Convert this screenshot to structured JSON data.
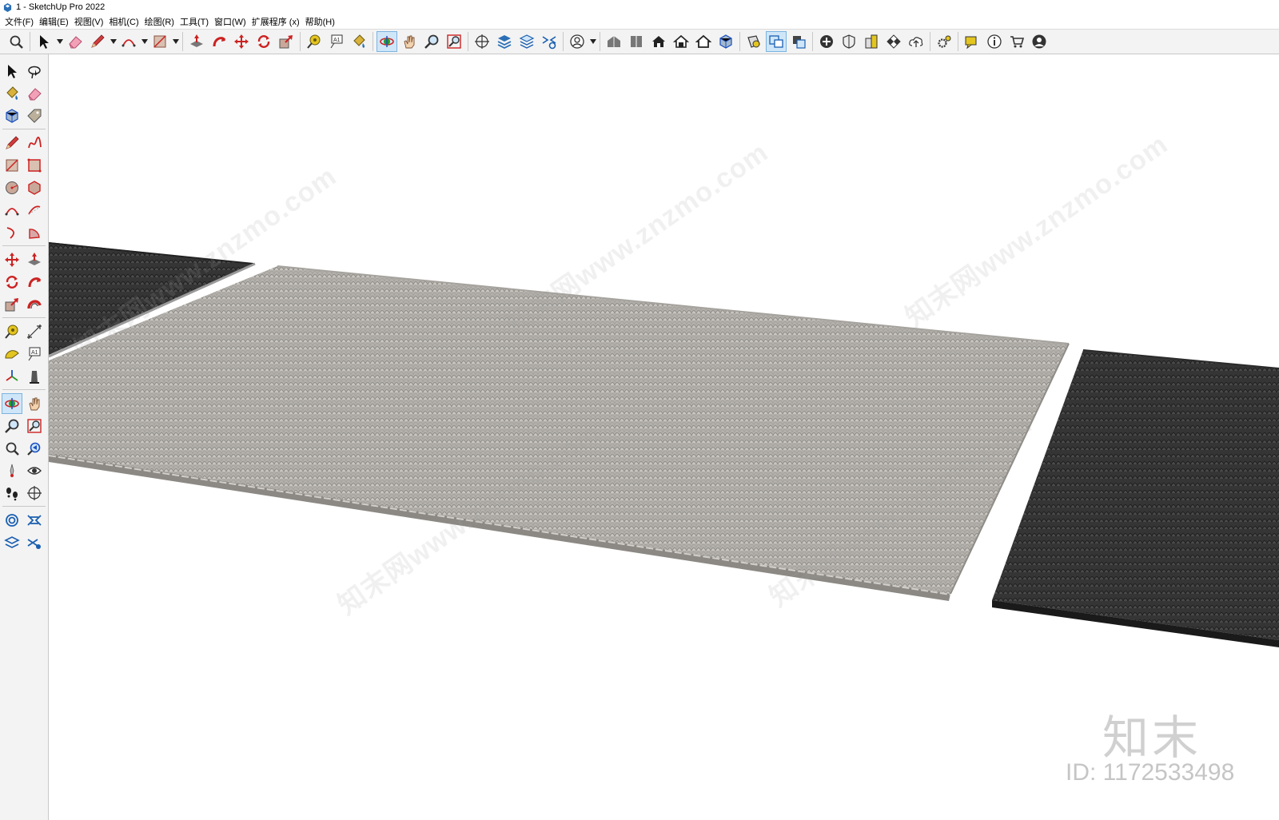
{
  "window": {
    "title": "1 - SketchUp Pro 2022",
    "app_icon": "sketchup-logo-icon"
  },
  "menu": [
    {
      "label": "文件(F)"
    },
    {
      "label": "编辑(E)"
    },
    {
      "label": "视图(V)"
    },
    {
      "label": "相机(C)"
    },
    {
      "label": "绘图(R)"
    },
    {
      "label": "工具(T)"
    },
    {
      "label": "窗口(W)"
    },
    {
      "label": "扩展程序 (x)"
    },
    {
      "label": "帮助(H)"
    }
  ],
  "toolbar": {
    "groups": [
      [
        "zoom-extents-icon"
      ],
      [
        "select-icon",
        "dropdown",
        "eraser-icon",
        "pencil-icon",
        "dropdown",
        "arc-icon",
        "dropdown",
        "rectangle-icon",
        "dropdown"
      ],
      [
        "push-pull-icon",
        "follow-me-icon",
        "move-icon",
        "rotate-icon",
        "scale-icon"
      ],
      [
        "tape-measure-icon",
        "text-icon",
        "paint-bucket-icon"
      ],
      [
        "orbit-icon",
        "pan-icon",
        "zoom-icon",
        "zoom-window-icon"
      ],
      [
        "section-plane-icon",
        "sandbox-icon",
        "layers-icon",
        "scenes-icon"
      ],
      [
        "account-icon",
        "dropdown"
      ],
      [
        "3d-warehouse-icon",
        "extension-warehouse-icon",
        "house-icon",
        "house-open-icon",
        "house-outline-icon",
        "component-icon"
      ],
      [
        "style-icon",
        "outliner-icon",
        "solid-tools-icon"
      ],
      [
        "add-location-icon",
        "shield-icon",
        "building-icon",
        "checker-icon",
        "cloud-upload-icon"
      ],
      [
        "gear-icon"
      ],
      [
        "message-icon",
        "info-icon",
        "cart-icon",
        "user-circle-icon"
      ]
    ],
    "active": [
      "orbit-icon",
      "outliner-icon"
    ]
  },
  "left_toolbar": {
    "rows": [
      [
        "select-icon",
        "lasso-select-icon"
      ],
      [
        "paint-bucket-icon",
        "eraser-icon"
      ],
      [
        "component-icon",
        "tag-icon"
      ],
      [
        "pencil-icon",
        "freehand-icon"
      ],
      [
        "rectangle-icon",
        "rotated-rectangle-icon"
      ],
      [
        "circle-icon",
        "polygon-icon"
      ],
      [
        "arc-icon",
        "two-point-arc-icon"
      ],
      [
        "three-point-arc-icon",
        "pie-icon"
      ],
      [
        "move-icon",
        "push-pull-icon"
      ],
      [
        "rotate-icon",
        "follow-me-icon"
      ],
      [
        "scale-icon",
        "offset-icon"
      ],
      [
        "tape-measure-icon",
        "dimension-icon"
      ],
      [
        "protractor-icon",
        "text-icon"
      ],
      [
        "axes-icon",
        "3d-text-icon"
      ],
      [
        "orbit-icon",
        "pan-icon"
      ],
      [
        "zoom-icon",
        "zoom-window-icon"
      ],
      [
        "zoom-extents-icon",
        "previous-view-icon"
      ],
      [
        "position-camera-icon",
        "look-around-icon"
      ],
      [
        "walk-icon",
        "section-plane-icon"
      ],
      [
        "sandbox-from-contours-icon",
        "sandbox-from-scratch-icon"
      ],
      [
        "smoove-icon",
        "stamp-icon"
      ]
    ],
    "active": [
      "orbit-icon"
    ]
  },
  "scene": {
    "description_colors": {
      "tile_light": "#b9b6b1",
      "tile_light_shadow": "#8a8782",
      "tile_dark": "#3c3c3c",
      "tile_darker": "#222222",
      "ground": "#ffffff"
    },
    "objects": [
      {
        "name": "dark-tile-roof-left"
      },
      {
        "name": "light-tile-roof-center"
      },
      {
        "name": "dark-tile-roof-right"
      }
    ]
  },
  "watermark": {
    "diagonal_text": "知末网www.znzmo.com",
    "logo": "知末",
    "id_label": "ID: 1172533498"
  }
}
